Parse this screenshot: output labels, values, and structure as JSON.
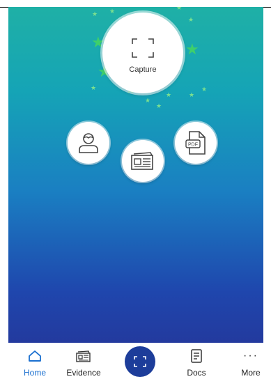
{
  "capture": {
    "label": "Capture"
  },
  "actions": [
    {
      "name": "person-action",
      "icon": "person-icon"
    },
    {
      "name": "evidence-card-action",
      "icon": "card-icon"
    },
    {
      "name": "pdf-action",
      "icon": "pdf-icon",
      "badge": "PDF"
    }
  ],
  "bottom_nav": {
    "home": "Home",
    "evidence": "Evidence",
    "docs": "Docs",
    "more": "More",
    "more_glyph": "···"
  },
  "colors": {
    "accent": "#1a6fcf",
    "center_button": "#1d3d9a",
    "gradient_top": "#1fb0a6",
    "gradient_bottom": "#233a9e",
    "star": "#3ecf6b"
  }
}
